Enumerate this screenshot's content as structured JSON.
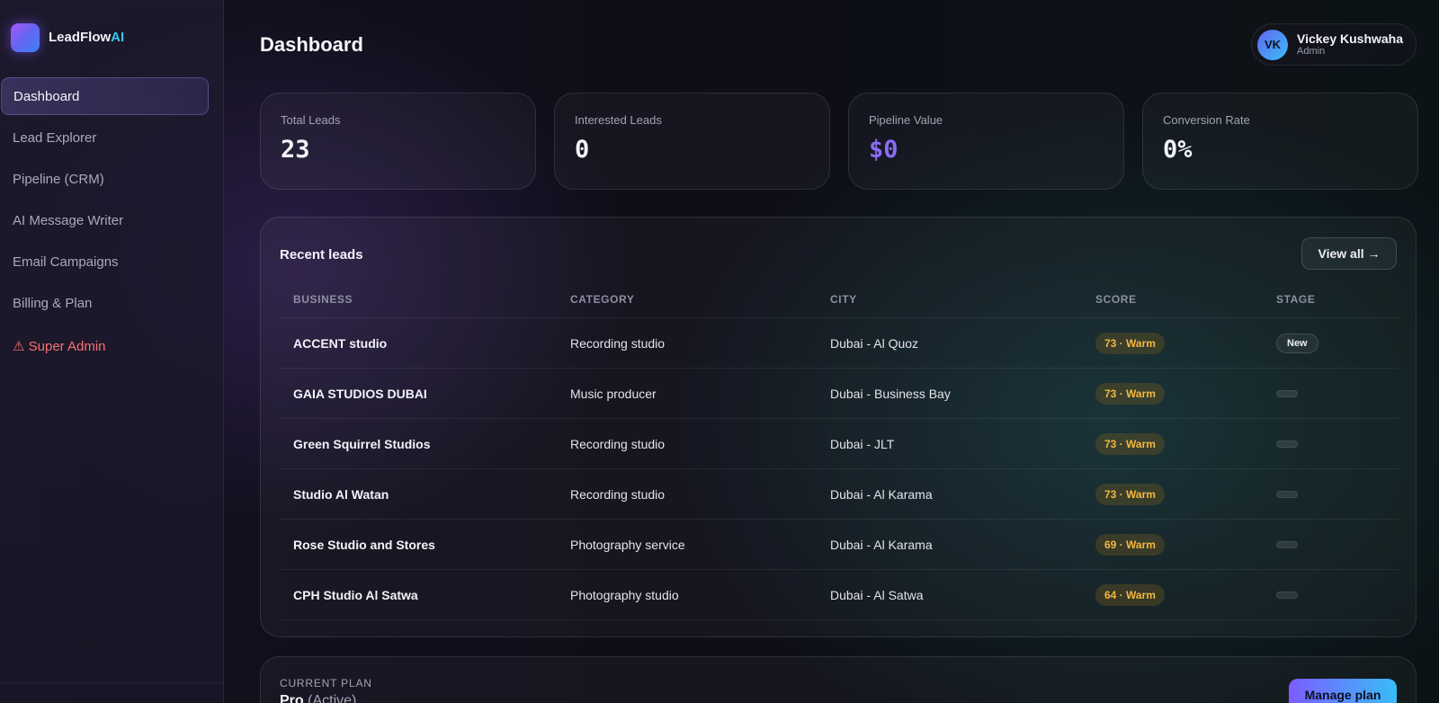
{
  "brand": {
    "name": "LeadFlow",
    "suffix": "AI",
    "accent_color": "#38c8f0"
  },
  "nav": {
    "items": [
      {
        "label": "Dashboard",
        "active": true
      },
      {
        "label": "Lead Explorer"
      },
      {
        "label": "Pipeline (CRM)"
      },
      {
        "label": "AI Message Writer"
      },
      {
        "label": "Email Campaigns"
      },
      {
        "label": "Billing & Plan"
      }
    ],
    "admin": {
      "icon": "warning-icon",
      "glyph": "⚠",
      "label": "Super Admin"
    }
  },
  "header": {
    "title": "Dashboard"
  },
  "user": {
    "initials": "VK",
    "name": "Vickey Kushwaha",
    "role": "Admin"
  },
  "stats": [
    {
      "label": "Total Leads",
      "value": "23"
    },
    {
      "label": "Interested Leads",
      "value": "0"
    },
    {
      "label": "Pipeline Value",
      "value": "$0",
      "color": "#8b6cf6"
    },
    {
      "label": "Conversion Rate",
      "value": "0%"
    }
  ],
  "recent_leads": {
    "title": "Recent leads",
    "view_all": "View all →",
    "columns": [
      "BUSINESS",
      "CATEGORY",
      "CITY",
      "SCORE",
      "STAGE"
    ],
    "rows": [
      {
        "business": "ACCENT studio",
        "category": "Recording studio",
        "city": "Dubai - Al Quoz",
        "score": "73 · Warm",
        "stage": "New"
      },
      {
        "business": "GAIA STUDIOS DUBAI",
        "category": "Music producer",
        "city": "Dubai - Business Bay",
        "score": "73 · Warm",
        "stage": ""
      },
      {
        "business": "Green Squirrel Studios",
        "category": "Recording studio",
        "city": "Dubai - JLT",
        "score": "73 · Warm",
        "stage": ""
      },
      {
        "business": "Studio Al Watan",
        "category": "Recording studio",
        "city": "Dubai - Al Karama",
        "score": "73 · Warm",
        "stage": ""
      },
      {
        "business": "Rose Studio and Stores",
        "category": "Photography service",
        "city": "Dubai - Al Karama",
        "score": "69 · Warm",
        "stage": ""
      },
      {
        "business": "CPH Studio Al Satwa",
        "category": "Photography studio",
        "city": "Dubai - Al Satwa",
        "score": "64 · Warm",
        "stage": ""
      }
    ]
  },
  "plan": {
    "label": "CURRENT PLAN",
    "name": "Pro",
    "status": "(Active)",
    "button": "Manage plan"
  }
}
